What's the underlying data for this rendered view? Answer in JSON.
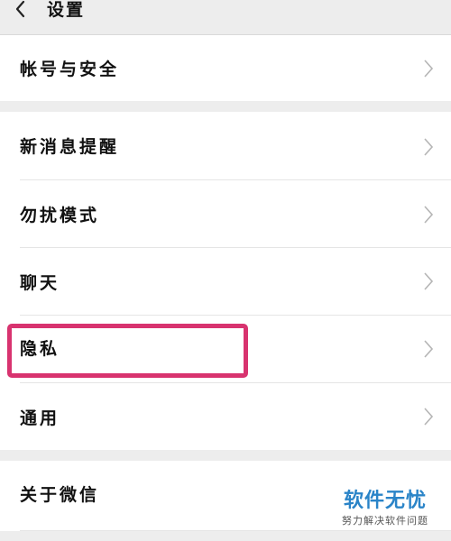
{
  "header": {
    "title": "设置"
  },
  "settings": {
    "account_security": "帐号与安全",
    "new_message_alert": "新消息提醒",
    "do_not_disturb": "勿扰模式",
    "chat": "聊天",
    "privacy": "隐私",
    "general": "通用",
    "about_wechat": "关于微信"
  },
  "annotation": {
    "highlight_color": "#d8336f"
  },
  "watermark": {
    "main": "软件无忧",
    "sub": "努力解决软件问题"
  },
  "icons": {
    "back": "chevron-left-icon",
    "row_arrow": "chevron-right-icon"
  }
}
